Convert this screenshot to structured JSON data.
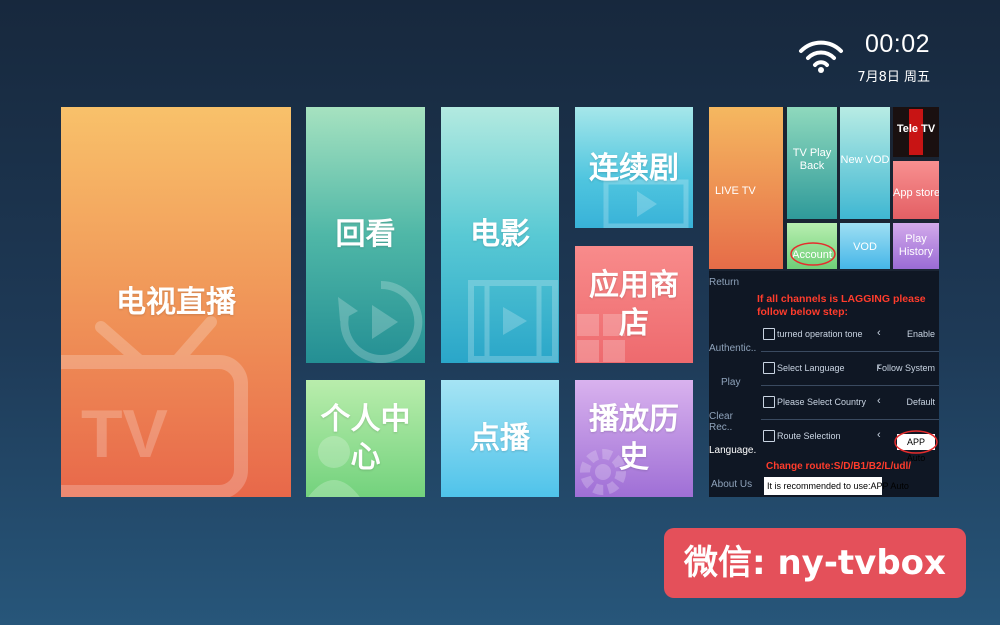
{
  "status": {
    "time": "00:02",
    "date": "7月8日 周五"
  },
  "tiles": {
    "live": "电视直播",
    "playback": "回看",
    "movies": "电影",
    "series": "连续剧",
    "app_store": "应用商店",
    "personal": "个人中心",
    "vod": "点播",
    "history": "播放历史"
  },
  "promo": {
    "mini_tiles": {
      "live": "LIVE TV",
      "playback": "TV Play Back",
      "new_vod": "New VOD",
      "tele": "Tele TV",
      "store": "App store",
      "account": "Account",
      "vod": "VOD",
      "history": "Play History"
    },
    "side_menu": [
      "Return",
      "Authentic..",
      "Play",
      "Clear Rec..",
      "Language.",
      "About Us"
    ],
    "warning": "If all channels is LAGGING please follow below step:",
    "rows": [
      {
        "name": "turned operation tone",
        "value": "Enable"
      },
      {
        "name": "Select Language",
        "value": "Follow System"
      },
      {
        "name": "Please Select Country",
        "value": "Default"
      },
      {
        "name": "Route Selection",
        "value": "APP Auto"
      }
    ],
    "change_route": "Change route:S/D/B1/B2/L/udl/",
    "recommend": "It is recommended to use:APP Auto"
  },
  "wechat": "微信: ny-tvbox"
}
